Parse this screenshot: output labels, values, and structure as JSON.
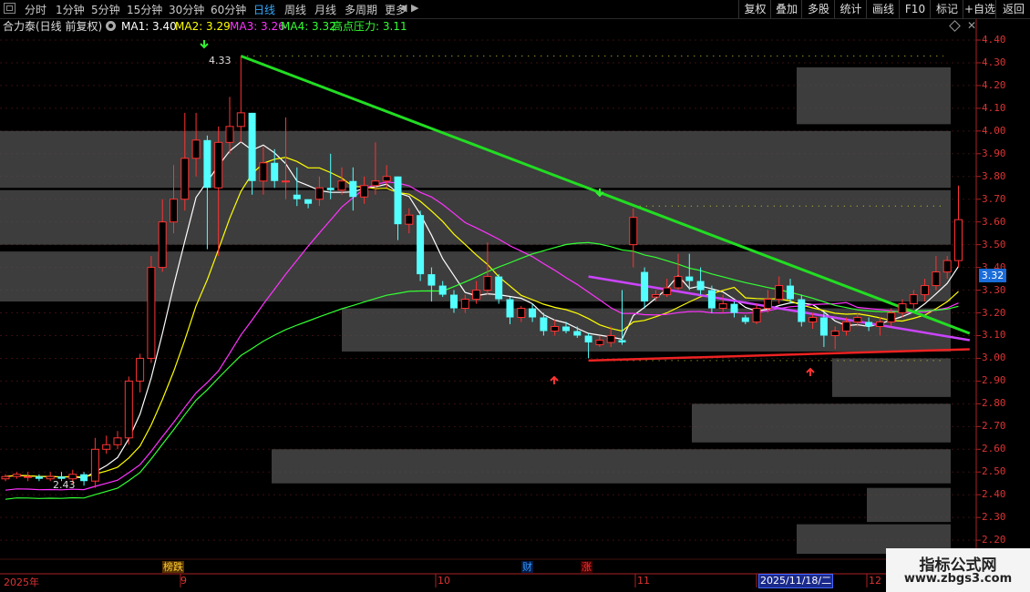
{
  "toolbar": {
    "periods": [
      {
        "label": "分时",
        "active": false
      },
      {
        "label": "1分钟",
        "active": false
      },
      {
        "label": "5分钟",
        "active": false
      },
      {
        "label": "15分钟",
        "active": false
      },
      {
        "label": "30分钟",
        "active": false
      },
      {
        "label": "60分钟",
        "active": false
      },
      {
        "label": "日线",
        "active": true
      },
      {
        "label": "周线",
        "active": false
      },
      {
        "label": "月线",
        "active": false
      },
      {
        "label": "多周期",
        "active": false
      },
      {
        "label": "更多",
        "active": false
      }
    ],
    "right_buttons": [
      "复权",
      "叠加",
      "多股",
      "统计",
      "画线",
      "F10",
      "标记",
      "+自选",
      "返回"
    ]
  },
  "legend": {
    "stock": "合力泰(日线 前复权)",
    "ma1": "MA1: 3.40",
    "ma2": "MA2: 3.29",
    "ma3": "MA3: 3.26",
    "ma4": "MA4: 3.32",
    "pressure": "高点压力: 3.11",
    "colors": {
      "ma1": "#ffffff",
      "ma2": "#ffff00",
      "ma3": "#ff33ff",
      "ma4": "#33ff33",
      "pressure": "#33ff33"
    }
  },
  "chart_data": {
    "type": "candlestick",
    "y_axis_ticks": [
      "4.40",
      "4.30",
      "4.20",
      "4.10",
      "4.00",
      "3.90",
      "3.80",
      "3.70",
      "3.60",
      "3.50",
      "3.40",
      "3.30",
      "3.20",
      "3.10",
      "3.00",
      "2.90",
      "2.80",
      "2.70",
      "2.60",
      "2.50",
      "2.40",
      "2.30",
      "2.20"
    ],
    "ylim": [
      2.15,
      4.45
    ],
    "current_price": "3.32",
    "high_label": "4.33",
    "low_label": "2.43",
    "x_labels": [
      "2025年",
      "9",
      "10",
      "11",
      "2025/11/18/二",
      "12"
    ],
    "markers": [
      {
        "label": "榜跌",
        "color": "#ffcc33"
      },
      {
        "label": "财",
        "color": "#3399ff"
      },
      {
        "label": "涨",
        "color": "#ff3333"
      }
    ],
    "candles": [
      [
        2.47,
        2.48,
        2.49,
        2.46
      ],
      [
        2.48,
        2.49,
        2.5,
        2.47
      ],
      [
        2.48,
        2.48,
        2.5,
        2.46
      ],
      [
        2.48,
        2.47,
        2.49,
        2.46
      ],
      [
        2.47,
        2.48,
        2.5,
        2.46
      ],
      [
        2.48,
        2.47,
        2.5,
        2.46
      ],
      [
        2.47,
        2.49,
        2.51,
        2.45
      ],
      [
        2.49,
        2.46,
        2.5,
        2.44
      ],
      [
        2.46,
        2.6,
        2.65,
        2.43
      ],
      [
        2.6,
        2.62,
        2.66,
        2.58
      ],
      [
        2.62,
        2.65,
        2.68,
        2.6
      ],
      [
        2.65,
        2.9,
        2.92,
        2.62
      ],
      [
        2.9,
        3.0,
        3.02,
        2.85
      ],
      [
        3.0,
        3.4,
        3.45,
        2.98
      ],
      [
        3.4,
        3.6,
        3.7,
        3.38
      ],
      [
        3.6,
        3.7,
        3.85,
        3.55
      ],
      [
        3.7,
        3.88,
        4.08,
        3.65
      ],
      [
        3.88,
        3.96,
        4.08,
        3.8
      ],
      [
        3.96,
        3.75,
        3.98,
        3.48
      ],
      [
        3.75,
        3.95,
        4.02,
        3.45
      ],
      [
        3.95,
        4.02,
        4.15,
        3.9
      ],
      [
        4.02,
        4.08,
        4.33,
        3.95
      ],
      [
        4.08,
        3.78,
        4.08,
        3.72
      ],
      [
        3.78,
        3.86,
        3.93,
        3.72
      ],
      [
        3.86,
        3.78,
        3.92,
        3.75
      ],
      [
        3.78,
        3.78,
        4.06,
        3.7
      ],
      [
        3.72,
        3.7,
        3.84,
        3.67
      ],
      [
        3.7,
        3.68,
        3.69,
        3.66
      ],
      [
        3.7,
        3.75,
        3.8,
        3.67
      ],
      [
        3.75,
        3.74,
        3.9,
        3.7
      ],
      [
        3.74,
        3.78,
        3.84,
        3.72
      ],
      [
        3.78,
        3.71,
        3.84,
        3.65
      ],
      [
        3.71,
        3.76,
        3.8,
        3.68
      ],
      [
        3.76,
        3.78,
        3.95,
        3.72
      ],
      [
        3.78,
        3.8,
        3.85,
        3.75
      ],
      [
        3.8,
        3.59,
        3.8,
        3.52
      ],
      [
        3.59,
        3.63,
        3.66,
        3.55
      ],
      [
        3.63,
        3.37,
        3.65,
        3.34
      ],
      [
        3.37,
        3.32,
        3.4,
        3.25
      ],
      [
        3.32,
        3.28,
        3.34,
        3.27
      ],
      [
        3.28,
        3.22,
        3.3,
        3.2
      ],
      [
        3.22,
        3.26,
        3.28,
        3.2
      ],
      [
        3.26,
        3.3,
        3.34,
        3.24
      ],
      [
        3.3,
        3.36,
        3.51,
        3.28
      ],
      [
        3.36,
        3.26,
        3.37,
        3.24
      ],
      [
        3.26,
        3.18,
        3.27,
        3.15
      ],
      [
        3.18,
        3.22,
        3.23,
        3.16
      ],
      [
        3.22,
        3.18,
        3.24,
        3.16
      ],
      [
        3.18,
        3.12,
        3.2,
        3.1
      ],
      [
        3.12,
        3.14,
        3.17,
        3.1
      ],
      [
        3.14,
        3.12,
        3.16,
        3.11
      ],
      [
        3.12,
        3.1,
        3.14,
        3.09
      ],
      [
        3.1,
        3.07,
        3.11,
        3.0
      ],
      [
        3.06,
        3.08,
        3.1,
        3.05
      ],
      [
        3.07,
        3.1,
        3.14,
        3.05
      ],
      [
        3.08,
        3.07,
        3.3,
        3.06
      ],
      [
        3.5,
        3.62,
        3.66,
        3.4
      ],
      [
        3.38,
        3.25,
        3.4,
        3.22
      ],
      [
        3.27,
        3.28,
        3.3,
        3.25
      ],
      [
        3.28,
        3.31,
        3.35,
        3.27
      ],
      [
        3.31,
        3.36,
        3.46,
        3.3
      ],
      [
        3.36,
        3.34,
        3.46,
        3.3
      ],
      [
        3.34,
        3.3,
        3.4,
        3.28
      ],
      [
        3.3,
        3.22,
        3.32,
        3.2
      ],
      [
        3.22,
        3.24,
        3.28,
        3.2
      ],
      [
        3.24,
        3.2,
        3.25,
        3.18
      ],
      [
        3.18,
        3.16,
        3.19,
        3.15
      ],
      [
        3.16,
        3.22,
        3.24,
        3.15
      ],
      [
        3.22,
        3.26,
        3.3,
        3.2
      ],
      [
        3.26,
        3.32,
        3.36,
        3.24
      ],
      [
        3.32,
        3.26,
        3.35,
        3.24
      ],
      [
        3.26,
        3.16,
        3.28,
        3.14
      ],
      [
        3.16,
        3.18,
        3.2,
        3.13
      ],
      [
        3.18,
        3.1,
        3.2,
        3.05
      ],
      [
        3.1,
        3.12,
        3.14,
        3.04
      ],
      [
        3.12,
        3.16,
        3.18,
        3.1
      ],
      [
        3.16,
        3.18,
        3.2,
        3.14
      ],
      [
        3.16,
        3.14,
        3.18,
        3.12
      ],
      [
        3.14,
        3.16,
        3.18,
        3.1
      ],
      [
        3.16,
        3.2,
        3.22,
        3.14
      ],
      [
        3.2,
        3.24,
        3.26,
        3.18
      ],
      [
        3.24,
        3.28,
        3.3,
        3.22
      ],
      [
        3.28,
        3.32,
        3.35,
        3.25
      ],
      [
        3.32,
        3.38,
        3.45,
        3.3
      ],
      [
        3.38,
        3.43,
        3.45,
        3.35
      ],
      [
        3.43,
        3.61,
        3.76,
        3.4
      ]
    ],
    "ma_series": [
      {
        "name": "MA1",
        "color": "#ffffff"
      },
      {
        "name": "MA2",
        "color": "#ffff00"
      },
      {
        "name": "MA3",
        "color": "#ff33ff"
      },
      {
        "name": "MA4",
        "color": "#33ff33"
      }
    ],
    "trend_lines": [
      {
        "color": "#22dd22",
        "from": [
          21,
          4.33
        ],
        "to": [
          86,
          3.11
        ]
      },
      {
        "color": "#ee2222",
        "from": [
          52,
          2.99
        ],
        "to": [
          86,
          3.04
        ]
      },
      {
        "color": "#cc44ff",
        "from": [
          52,
          3.36
        ],
        "to": [
          86,
          3.08
        ]
      }
    ],
    "support_zones_note": "gray overlay bands"
  },
  "watermark": {
    "title": "指标公式网",
    "url": "www.zbgs3.com"
  }
}
